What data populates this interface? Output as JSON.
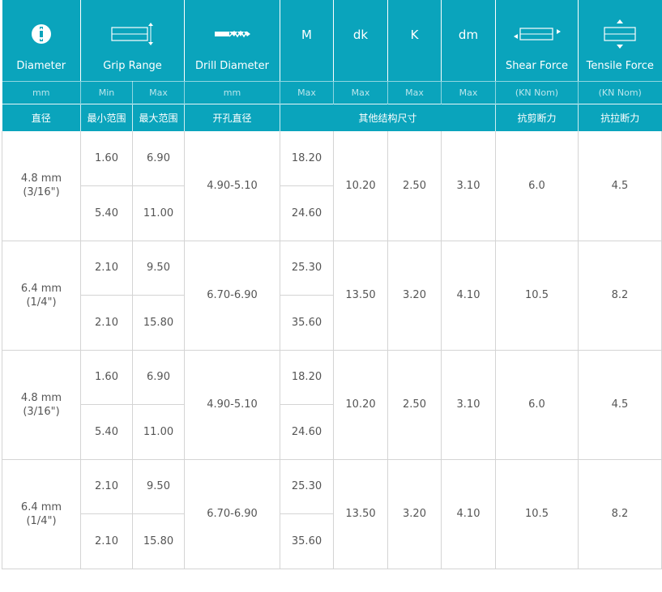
{
  "header": {
    "diameter": {
      "title": "Diameter",
      "sub": "mm",
      "cn": "直径",
      "icon": "rivet-head-icon"
    },
    "grip_range": {
      "title": "Grip Range",
      "min": "Min",
      "max": "Max",
      "cn_min": "最小范围",
      "cn_max": "最大范围",
      "icon": "grip-range-icon"
    },
    "drill_diameter": {
      "title": "Drill Diameter",
      "sub": "mm",
      "cn": "开孔直径",
      "icon": "drill-bit-icon"
    },
    "m": {
      "title": "M",
      "sub": "Max"
    },
    "dk": {
      "title": "dk",
      "sub": "Max"
    },
    "k": {
      "title": "K",
      "sub": "Max"
    },
    "dm": {
      "title": "dm",
      "sub": "Max"
    },
    "other_dims_cn": "其他结构尺寸",
    "shear_force": {
      "title": "Shear Force",
      "sub": "(KN Nom)",
      "cn": "抗剪断力",
      "icon": "shear-force-icon"
    },
    "tensile_force": {
      "title": "Tensile Force",
      "sub": "(KN Nom)",
      "cn": "抗拉断力",
      "icon": "tensile-force-icon"
    }
  },
  "rows": [
    {
      "diameter": "4.8 mm",
      "inch": "(3/16\")",
      "grip": [
        {
          "min": "1.60",
          "max": "6.90",
          "m": "18.20"
        },
        {
          "min": "5.40",
          "max": "11.00",
          "m": "24.60"
        }
      ],
      "drill": "4.90-5.10",
      "dk": "10.20",
      "k": "2.50",
      "dm": "3.10",
      "shear": "6.0",
      "tensile": "4.5"
    },
    {
      "diameter": "6.4 mm",
      "inch": "(1/4\")",
      "grip": [
        {
          "min": "2.10",
          "max": "9.50",
          "m": "25.30"
        },
        {
          "min": "2.10",
          "max": "15.80",
          "m": "35.60"
        }
      ],
      "drill": "6.70-6.90",
      "dk": "13.50",
      "k": "3.20",
      "dm": "4.10",
      "shear": "10.5",
      "tensile": "8.2"
    },
    {
      "diameter": "4.8 mm",
      "inch": "(3/16\")",
      "grip": [
        {
          "min": "1.60",
          "max": "6.90",
          "m": "18.20"
        },
        {
          "min": "5.40",
          "max": "11.00",
          "m": "24.60"
        }
      ],
      "drill": "4.90-5.10",
      "dk": "10.20",
      "k": "2.50",
      "dm": "3.10",
      "shear": "6.0",
      "tensile": "4.5"
    },
    {
      "diameter": "6.4 mm",
      "inch": "(1/4\")",
      "grip": [
        {
          "min": "2.10",
          "max": "9.50",
          "m": "25.30"
        },
        {
          "min": "2.10",
          "max": "15.80",
          "m": "35.60"
        }
      ],
      "drill": "6.70-6.90",
      "dk": "13.50",
      "k": "3.20",
      "dm": "4.10",
      "shear": "10.5",
      "tensile": "8.2"
    }
  ]
}
